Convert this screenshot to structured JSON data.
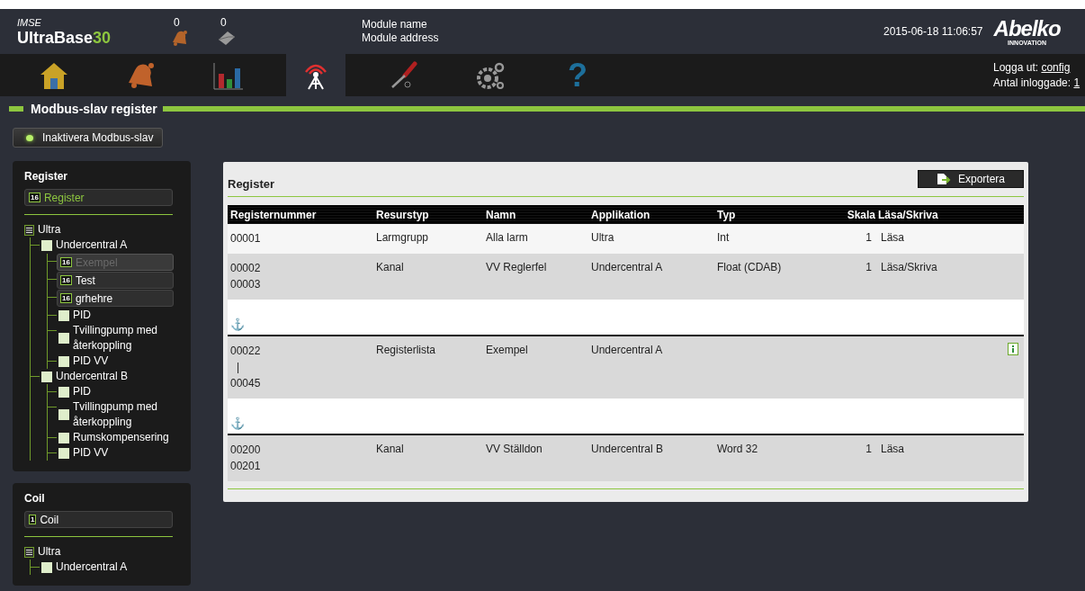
{
  "header": {
    "brand_small": "IMSE",
    "brand_name": "UltraBase",
    "brand_number": "30",
    "counters": [
      {
        "count": "0"
      },
      {
        "count": "0"
      }
    ],
    "module_name": "Module name",
    "module_address": "Module address",
    "datetime": "2015-06-18 11:06:57",
    "logo_name": "Abelko",
    "logo_sub": "INNOVATION"
  },
  "nav": {
    "tabs": [
      {
        "selected": false
      },
      {
        "selected": false
      },
      {
        "selected": false
      },
      {
        "selected": true
      },
      {
        "selected": false
      },
      {
        "selected": false
      },
      {
        "glyph": "?",
        "selected": false
      }
    ],
    "logout_label": "Logga ut:",
    "logout_user": "config",
    "logged_in_label": "Antal inloggade:",
    "logged_in_count": "1"
  },
  "page_title": "Modbus-slav register",
  "toggle_button": {
    "label": "Inaktivera Modbus-slav",
    "on": true
  },
  "sidebar": [
    {
      "title": "Register",
      "badge": "16",
      "button": "Register",
      "tree": [
        {
          "label": "Ultra",
          "children": [
            {
              "label": "Undercentral A",
              "children": [
                {
                  "kind": "register",
                  "badge": "16",
                  "label": "Exempel",
                  "disabled": true
                },
                {
                  "kind": "register",
                  "badge": "16",
                  "label": "Test",
                  "disabled": false
                },
                {
                  "kind": "register",
                  "badge": "16",
                  "label": "grhehre",
                  "disabled": false
                },
                {
                  "kind": "group",
                  "label": "PID"
                },
                {
                  "kind": "group",
                  "label": "Tvillingpump med återkoppling"
                },
                {
                  "kind": "group",
                  "label": "PID VV"
                }
              ]
            },
            {
              "label": "Undercentral B",
              "children": [
                {
                  "kind": "group",
                  "label": "PID"
                },
                {
                  "kind": "group",
                  "label": "Tvillingpump med återkoppling"
                },
                {
                  "kind": "group",
                  "label": "Rumskompensering"
                },
                {
                  "kind": "group",
                  "label": "PID VV"
                }
              ]
            }
          ]
        }
      ]
    },
    {
      "title": "Coil",
      "badge": "1",
      "button": "Coil",
      "tree": [
        {
          "label": "Ultra",
          "children": [
            {
              "label": "Undercentral A"
            }
          ]
        }
      ]
    }
  ],
  "panel": {
    "title": "Register",
    "export_button": "Exportera",
    "table": {
      "columns": [
        "Registernummer",
        "Resurstyp",
        "Namn",
        "Applikation",
        "Typ",
        "Skala",
        "Läsa/Skriva"
      ],
      "rows": [
        {
          "kind": "row",
          "numbers": [
            "00001"
          ],
          "resource": "Larmgrupp",
          "name": "Alla larm",
          "application": "Ultra",
          "type": "Int",
          "scale": "1",
          "access": "Läsa"
        },
        {
          "kind": "row",
          "numbers": [
            "00002",
            "00003"
          ],
          "resource": "Kanal",
          "name": "VV Reglerfel",
          "application": "Undercentral A",
          "type": "Float (CDAB)",
          "scale": "1",
          "access": "Läsa/Skriva"
        },
        {
          "kind": "gap",
          "anchor": "⚓"
        },
        {
          "kind": "row",
          "numbers": [
            "00022",
            "|",
            "00045"
          ],
          "resource": "Registerlista",
          "name": "Exempel",
          "application": "Undercentral A",
          "info": true
        },
        {
          "kind": "gap",
          "anchor": "⚓"
        },
        {
          "kind": "row",
          "numbers": [
            "00200",
            "00201"
          ],
          "resource": "Kanal",
          "name": "VV Ställdon",
          "application": "Undercentral B",
          "type": "Word 32",
          "scale": "1",
          "access": "Läsa"
        }
      ]
    }
  }
}
